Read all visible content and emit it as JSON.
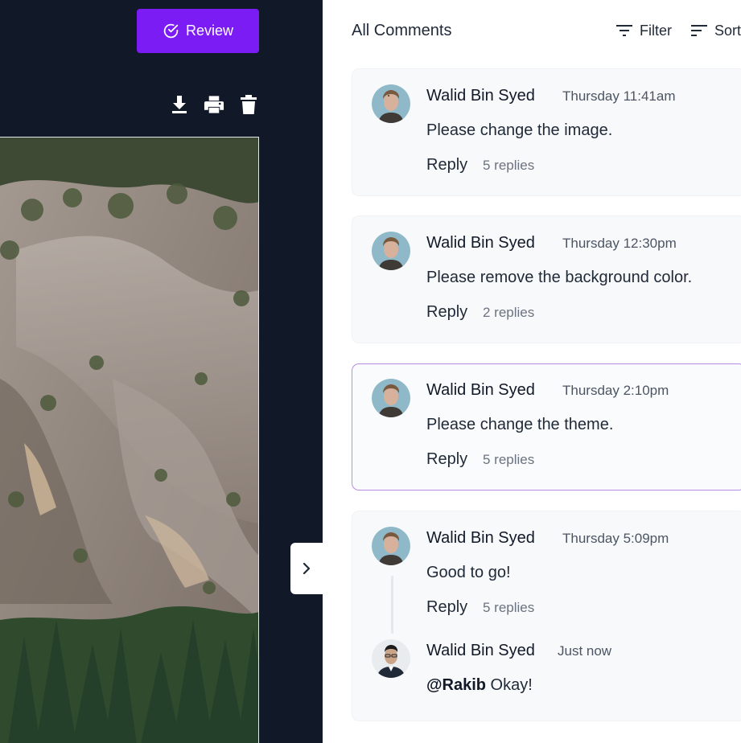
{
  "toolbar": {
    "review_label": "Review",
    "icons": [
      "check-circle-icon",
      "download-icon",
      "print-icon",
      "trash-icon",
      "chevron-right-icon"
    ]
  },
  "comments_panel": {
    "title": "All Comments",
    "filter_label": "Filter",
    "sort_label": "Sort",
    "comments": [
      {
        "author": "Walid Bin Syed",
        "time": "Thursday 11:41am",
        "text": "Please change the image.",
        "reply_label": "Reply",
        "replies": "5 replies"
      },
      {
        "author": "Walid Bin Syed",
        "time": "Thursday 12:30pm",
        "text": "Please remove the background color.",
        "reply_label": "Reply",
        "replies": "2 replies"
      },
      {
        "author": "Walid Bin Syed",
        "time": "Thursday 2:10pm",
        "text": "Please change the theme.",
        "reply_label": "Reply",
        "replies": "5 replies",
        "active": true
      },
      {
        "author": "Walid Bin Syed",
        "time": "Thursday 5:09pm",
        "text": "Good to go!",
        "reply_label": "Reply",
        "replies": "5 replies",
        "reply": {
          "author": "Walid Bin Syed",
          "time": "Just now",
          "mention": "@Rakib",
          "text": " Okay!"
        }
      }
    ]
  },
  "colors": {
    "accent": "#7c1cf5",
    "dark_bg": "#111827",
    "active_border": "#b88de8"
  }
}
